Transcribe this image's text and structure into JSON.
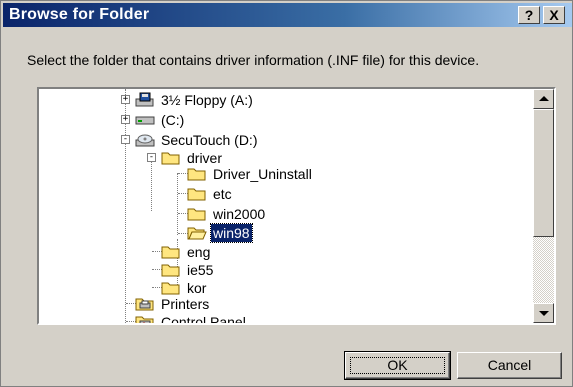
{
  "window": {
    "title": "Browse for Folder",
    "help_label": "?",
    "close_label": "X"
  },
  "prompt": "Select the folder that contains driver information (.INF file) for this device.",
  "tree": {
    "items": [
      {
        "label": "3½ Floppy (A:)",
        "icon": "floppy-drive-icon",
        "expander": "+"
      },
      {
        "label": "(C:)",
        "icon": "hard-drive-icon",
        "expander": "+"
      },
      {
        "label": "SecuTouch (D:)",
        "icon": "cd-drive-icon",
        "expander": "-"
      },
      {
        "label": "driver",
        "icon": "folder-open-icon",
        "expander": "-"
      },
      {
        "label": "Driver_Uninstall",
        "icon": "folder-icon"
      },
      {
        "label": "etc",
        "icon": "folder-icon"
      },
      {
        "label": "win2000",
        "icon": "folder-icon"
      },
      {
        "label": "win98",
        "icon": "folder-open-icon",
        "selected": true
      },
      {
        "label": "eng",
        "icon": "folder-icon"
      },
      {
        "label": "ie55",
        "icon": "folder-icon"
      },
      {
        "label": "kor",
        "icon": "folder-icon"
      },
      {
        "label": "Printers",
        "icon": "printers-icon"
      },
      {
        "label": "Control Panel",
        "icon": "control-panel-icon"
      }
    ]
  },
  "buttons": {
    "ok_label": "OK",
    "cancel_label": "Cancel"
  },
  "colors": {
    "titlebar": "#0a246a",
    "selection": "#0a246a",
    "dialog_bg": "#d4d0c8"
  }
}
